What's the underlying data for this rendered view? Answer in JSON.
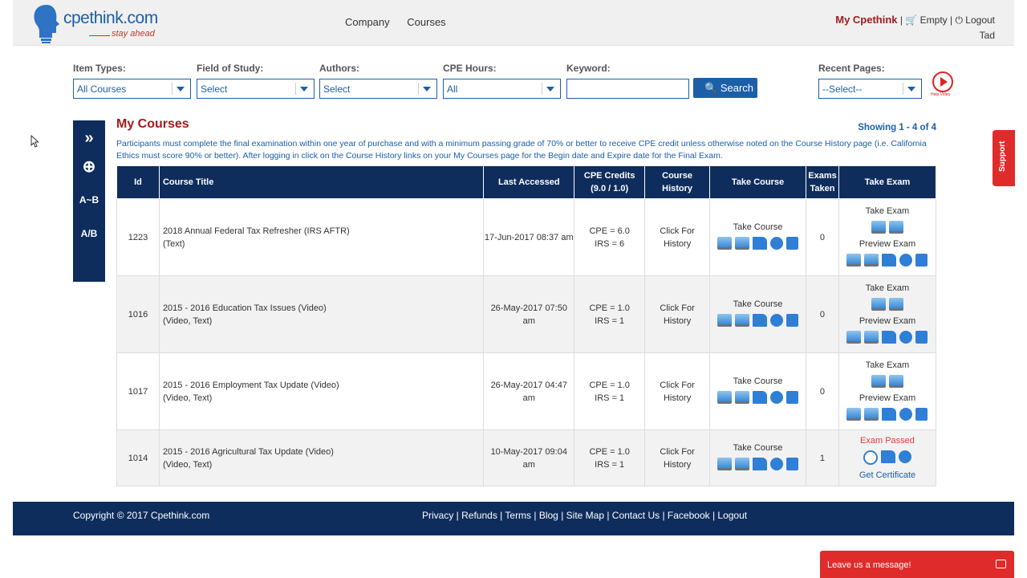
{
  "header": {
    "logo_text": "cpethink.com",
    "logo_tag": "stay ahead",
    "nav": [
      "Company",
      "Courses"
    ],
    "account": {
      "my": "My Cpethink",
      "cart": "Empty",
      "logout": "Logout",
      "user": "Tad"
    }
  },
  "filters": {
    "item_types": {
      "label": "Item Types:",
      "value": "All Courses"
    },
    "field_of_study": {
      "label": "Field of Study:",
      "value": "Select"
    },
    "authors": {
      "label": "Authors:",
      "value": "Select"
    },
    "cpe_hours": {
      "label": "CPE Hours:",
      "value": "All"
    },
    "keyword": {
      "label": "Keyword:",
      "value": ""
    },
    "search_label": "Search",
    "recent_pages": {
      "label": "Recent Pages:",
      "value": "--Select--"
    },
    "help_video": "Help Video"
  },
  "sidetool": {
    "expand": "»",
    "zoom": "⊕",
    "ab1": "A~B",
    "ab2": "A/B"
  },
  "main": {
    "title": "My Courses",
    "showing": "Showing 1 - 4 of 4",
    "notice": "Participants must complete the final examination within one year of purchase and with a minimum passing grade of 70% or better to receive CPE credit unless otherwise noted on the Course History page (i.e. California Ethics must score 90% or better). After logging in click on the Course History links on your My Courses page for the Begin date and Expire date for the Final Exam."
  },
  "table": {
    "headers": {
      "id": "Id",
      "title": "Course Title",
      "accessed": "Last Accessed",
      "credits_1": "CPE Credits",
      "credits_2": "(9.0 / 1.0)",
      "history_1": "Course",
      "history_2": "History",
      "take_course": "Take Course",
      "exams_1": "Exams",
      "exams_2": "Taken",
      "take_exam": "Take Exam"
    },
    "rows": [
      {
        "id": "1223",
        "title": "2018 Annual Federal Tax Refresher (IRS AFTR)",
        "format": "(Text)",
        "accessed_date": "17-Jun-2017 08:37 am",
        "accessed_time": "",
        "cpe": "CPE = 6.0",
        "irs": "IRS = 6",
        "history_1": "Click For",
        "history_2": "History",
        "take_course": "Take Course",
        "exams": "0",
        "take_exam": "Take Exam",
        "preview": "Preview Exam"
      },
      {
        "id": "1016",
        "title": "2015 - 2016 Education Tax Issues (Video)",
        "format": "(Video, Text)",
        "accessed_date": "26-May-2017 07:50",
        "accessed_time": "am",
        "cpe": "CPE = 1.0",
        "irs": "IRS = 1",
        "history_1": "Click For",
        "history_2": "History",
        "take_course": "Take Course",
        "exams": "0",
        "take_exam": "Take Exam",
        "preview": "Preview Exam"
      },
      {
        "id": "1017",
        "title": "2015 - 2016 Employment Tax Update (Video)",
        "format": "(Video, Text)",
        "accessed_date": "26-May-2017 04:47",
        "accessed_time": "am",
        "cpe": "CPE = 1.0",
        "irs": "IRS = 1",
        "history_1": "Click For",
        "history_2": "History",
        "take_course": "Take Course",
        "exams": "0",
        "take_exam": "Take Exam",
        "preview": "Preview Exam"
      },
      {
        "id": "1014",
        "title": "2015 - 2016 Agricultural Tax Update (Video)",
        "format": "(Video, Text)",
        "accessed_date": "10-May-2017 09:04",
        "accessed_time": "am",
        "cpe": "CPE = 1.0",
        "irs": "IRS = 1",
        "history_1": "Click For",
        "history_2": "History",
        "take_course": "Take Course",
        "exams": "1",
        "passed": "Exam Passed",
        "certificate": "Get Certificate"
      }
    ]
  },
  "footer": {
    "copyright": "Copyright © 2017 Cpethink.com",
    "links": "Privacy | Refunds | Terms | Blog | Site Map | Contact Us | Facebook | Logout"
  },
  "widgets": {
    "support": "Support",
    "chat": "Leave us a message!"
  },
  "colors": {
    "navy": "#0e2d5c",
    "brand_blue": "#1c5fa8",
    "accent_red": "#a11b1b",
    "support_red": "#e02b2b"
  }
}
